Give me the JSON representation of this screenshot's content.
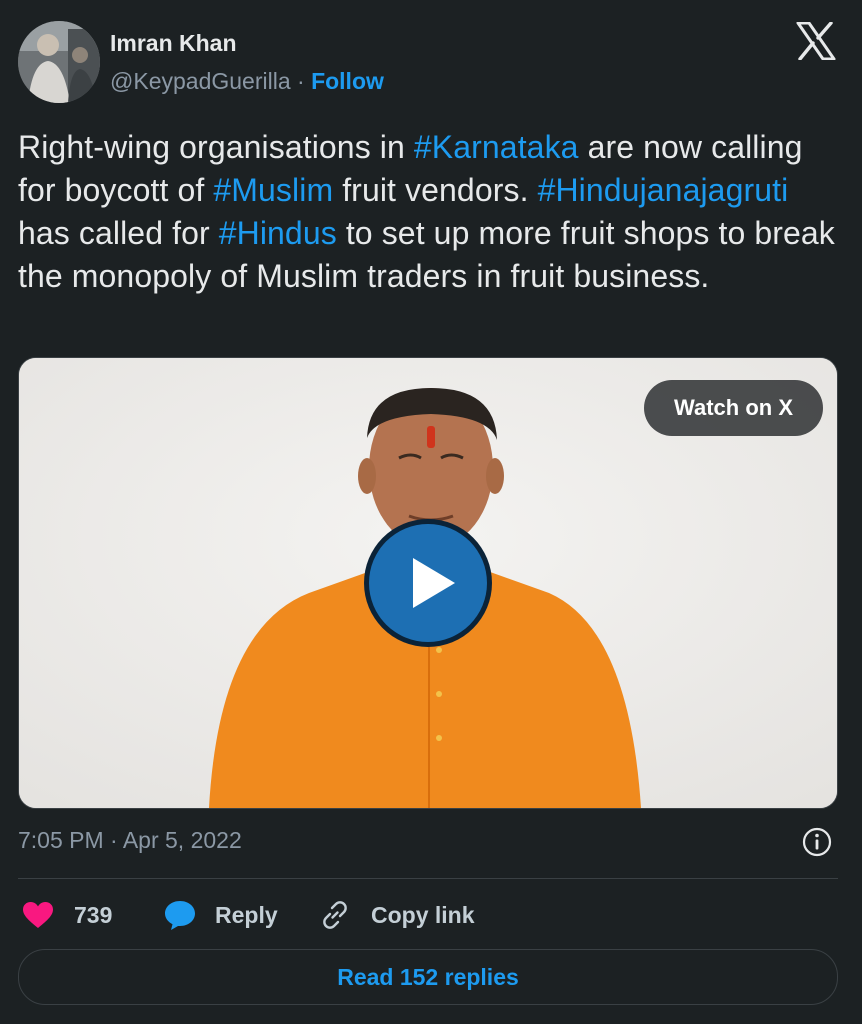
{
  "author": {
    "name": "Imran Khan",
    "handle": "@KeypadGuerilla",
    "separator": "·",
    "follow_label": "Follow"
  },
  "tweet": {
    "parts": [
      {
        "text": "Right-wing organisations in ",
        "type": "text"
      },
      {
        "text": "#Karnataka",
        "type": "hashtag"
      },
      {
        "text": " are now calling for boycott of ",
        "type": "text"
      },
      {
        "text": "#Muslim",
        "type": "hashtag"
      },
      {
        "text": " fruit vendors. ",
        "type": "text"
      },
      {
        "text": "#Hindujanajagruti",
        "type": "hashtag"
      },
      {
        "text": " has called for ",
        "type": "text"
      },
      {
        "text": "#Hindus",
        "type": "hashtag"
      },
      {
        "text": " to set up more fruit shops to break the monopoly of Muslim traders in fruit business.",
        "type": "text"
      }
    ]
  },
  "media": {
    "watch_label": "Watch on X",
    "play_icon": "play-icon"
  },
  "meta": {
    "timestamp": "7:05 PM · Apr 5, 2022"
  },
  "actions": {
    "likes": "739",
    "reply_label": "Reply",
    "copy_link_label": "Copy link"
  },
  "footer": {
    "read_replies_label": "Read 152 replies"
  },
  "colors": {
    "background": "#1c2123",
    "accent": "#1d9bf0",
    "heart": "#f91880",
    "play_button": "#1d6fb3"
  },
  "icons": [
    "x-logo-icon",
    "play-icon",
    "info-icon",
    "heart-icon",
    "reply-bubble-icon",
    "link-icon"
  ]
}
